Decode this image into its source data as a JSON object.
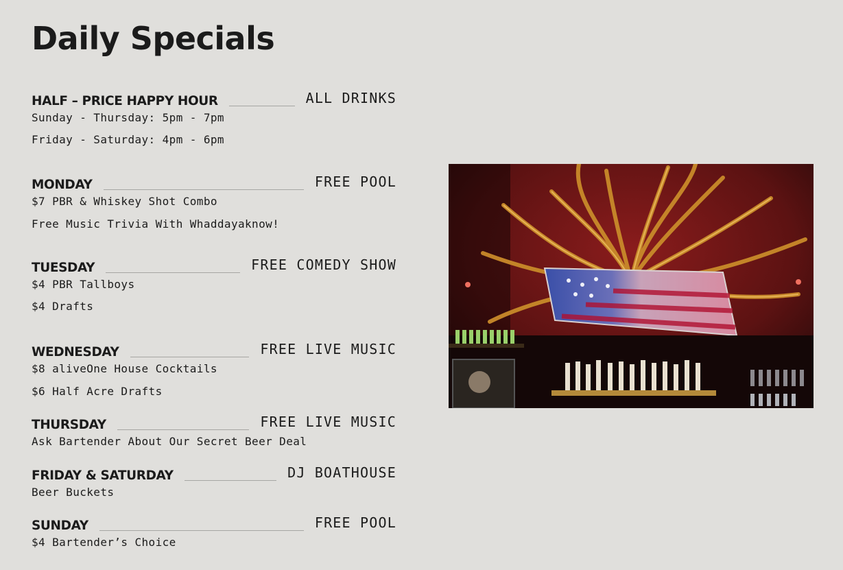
{
  "page": {
    "title": "Daily Specials"
  },
  "specials": [
    {
      "day": "HALF – PRICE HAPPY HOUR",
      "feature": "ALL DRINKS",
      "details": [
        "Sunday - Thursday: 5pm - 7pm",
        "Friday - Saturday: 4pm - 6pm"
      ]
    },
    {
      "day": "MONDAY",
      "feature": "FREE POOL",
      "details": [
        "$7 PBR & Whiskey Shot Combo",
        "Free Music Trivia With Whaddayaknow!"
      ]
    },
    {
      "day": "TUESDAY",
      "feature": "FREE COMEDY SHOW",
      "details": [
        "$4 PBR Tallboys",
        "$4 Drafts"
      ]
    },
    {
      "day": "WEDNESDAY",
      "feature": "FREE LIVE MUSIC",
      "details": [
        "$8 aliveOne House Cocktails",
        "$6 Half Acre Drafts"
      ]
    },
    {
      "day": "THURSDAY",
      "feature": "FREE LIVE MUSIC",
      "details": [
        "Ask Bartender About Our Secret Beer Deal"
      ]
    },
    {
      "day": "FRIDAY & SATURDAY",
      "feature": "DJ BOATHOUSE",
      "details": [
        "Beer Buckets"
      ]
    },
    {
      "day": "SUNDAY",
      "feature": "FREE POOL",
      "details": [
        "$4 Bartender’s Choice"
      ]
    }
  ],
  "colors": {
    "background": "#e0dfdc",
    "text": "#1b1b1b",
    "rule": "#a6a6a3"
  }
}
